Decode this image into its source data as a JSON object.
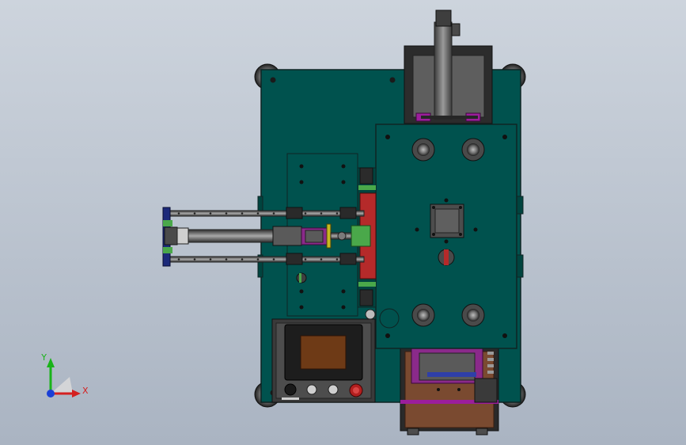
{
  "viewport": {
    "background_top": "#cdd4dd",
    "background_bottom": "#aab4c2"
  },
  "colors": {
    "plate": "#00524e",
    "plate_edge": "#0f2424",
    "frame": "#3a3a3a",
    "steel": "#6d6d6d",
    "magenta": "#9b1e9b",
    "red_block": "#b52a2a",
    "green_part": "#4aa84a",
    "yellow_part": "#c8b820",
    "navy_rail": "#1c2a7a",
    "copper": "#7a4a30",
    "orange_screen": "#6e3a16"
  },
  "triad": {
    "x_label": "X",
    "y_label": "Y",
    "x_color": "#d42020",
    "y_color": "#19b319",
    "z_color": "#1a3fd6"
  },
  "control_panel": {
    "button_count": 4,
    "stop_color": "#b21f1f"
  }
}
